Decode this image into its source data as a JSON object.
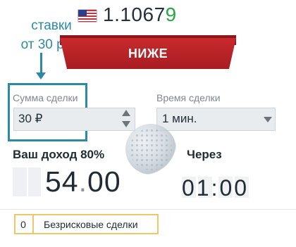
{
  "header": {
    "flag_icon": "us-flag-icon",
    "price_main": "1.1067",
    "price_last_digit": "9",
    "colors": {
      "price_up": "#27a745"
    }
  },
  "annotation": {
    "line1": "ставки",
    "line2": "от 30 руб.",
    "color": "#2d8aa8"
  },
  "trade": {
    "sell_label": "НИЖЕ",
    "sell_color": "#b82227"
  },
  "amount": {
    "label": "Сумма сделки",
    "value": "30 ₽"
  },
  "duration": {
    "label": "Время сделки",
    "value": "1 мин."
  },
  "payout": {
    "label": "Ваш доход 80%",
    "amount_int": "54",
    "amount_dec": "00"
  },
  "timer": {
    "label": "Через",
    "value": "01:00"
  },
  "risk_free": {
    "count": "0",
    "label": "Безрисковые сделки"
  }
}
